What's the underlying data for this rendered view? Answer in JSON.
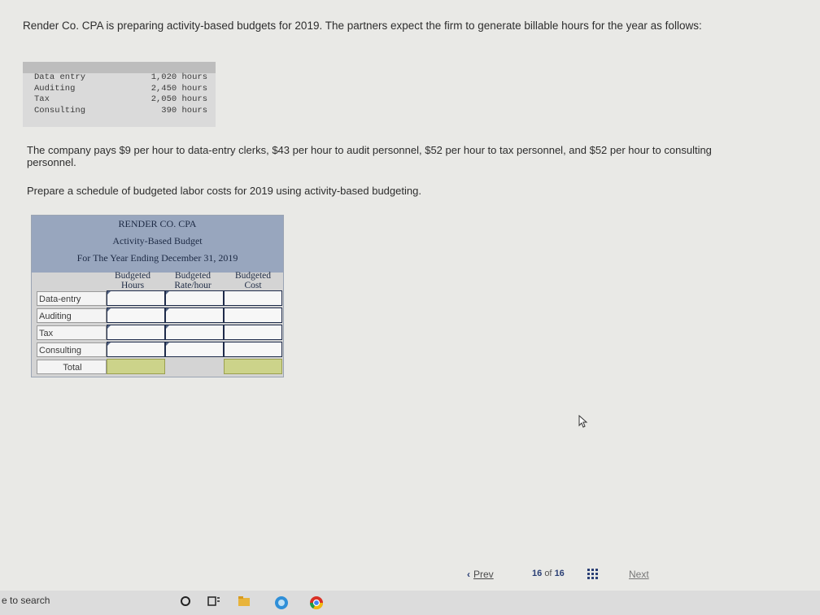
{
  "intro": "Render Co. CPA is preparing activity-based budgets for 2019. The partners expect the firm to generate billable hours for the year as follows:",
  "given": {
    "labels": [
      "Data entry",
      "Auditing",
      "Tax",
      "Consulting"
    ],
    "hours": [
      "1,020 hours",
      "2,450 hours",
      "2,050 hours",
      "390 hours"
    ]
  },
  "paragraph": "The company pays $9 per hour to data-entry clerks, $43 per hour to audit personnel, $52 per hour to tax personnel, and $52 per hour to consulting personnel.",
  "instruction": "Prepare a schedule of budgeted labor costs for 2019 using activity-based budgeting.",
  "budget": {
    "company": "RENDER CO. CPA",
    "title": "Activity-Based Budget",
    "period": "For The Year Ending December 31, 2019",
    "columns": [
      "Budgeted Hours",
      "Budgeted Rate/hour",
      "Budgeted Cost"
    ],
    "rows": [
      "Data-entry",
      "Auditing",
      "Tax",
      "Consulting"
    ],
    "total_label": "Total"
  },
  "nav": {
    "prev": "Prev",
    "page": "16",
    "of": "of",
    "total": "16",
    "next": "Next"
  },
  "taskbar": {
    "search": "e to search"
  }
}
